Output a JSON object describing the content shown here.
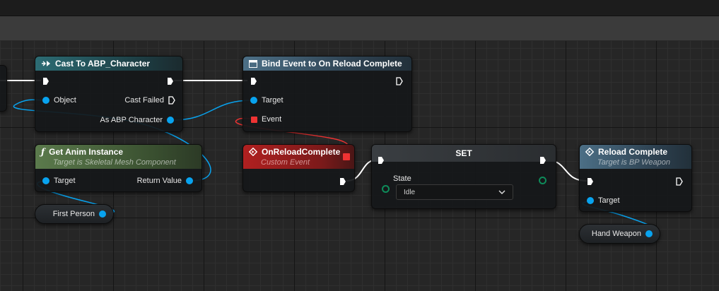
{
  "nodes": {
    "cast": {
      "title": "Cast To ABP_Character",
      "pin_object": "Object",
      "pin_cast_failed": "Cast Failed",
      "pin_as": "As ABP Character"
    },
    "bind": {
      "title": "Bind Event to On Reload Complete",
      "pin_target": "Target",
      "pin_event": "Event"
    },
    "anim": {
      "title": "Get Anim Instance",
      "subtitle": "Target is Skeletal Mesh Component",
      "pin_target": "Target",
      "pin_return": "Return Value"
    },
    "event": {
      "title": "OnReloadComplete",
      "subtitle": "Custom Event"
    },
    "set": {
      "title": "SET",
      "pin_state": "State",
      "state_value": "Idle"
    },
    "reload": {
      "title": "Reload Complete",
      "subtitle": "Target is BP Weapon",
      "pin_target": "Target"
    },
    "var_first_person": {
      "label": "First Person"
    },
    "var_hand_weapon": {
      "label": "Hand Weapon"
    }
  },
  "colors": {
    "exec": "#ffffff",
    "object": "#08a3ef",
    "delegate": "#ee3333",
    "byte": "#0e8c5a"
  },
  "icons": [
    "cast-icon",
    "bind-event-icon",
    "function-icon",
    "custom-event-icon",
    "delegate-output-icon",
    "chevron-down-icon",
    "reload-function-icon"
  ]
}
